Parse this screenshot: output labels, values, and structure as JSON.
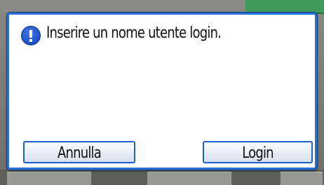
{
  "dialog": {
    "icon": "info-icon",
    "message": "Inserire un nome utente login.",
    "accent_color": "#2a6fd6"
  },
  "buttons": {
    "cancel_label": "Annulla",
    "login_label": "Login"
  }
}
